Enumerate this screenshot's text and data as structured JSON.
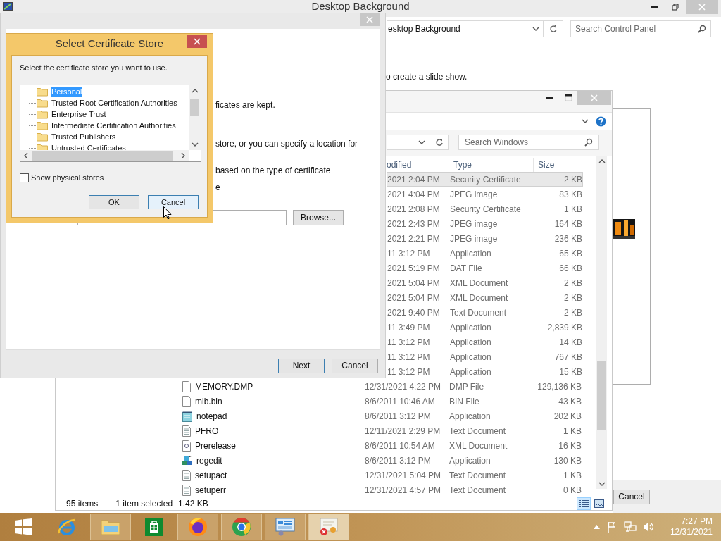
{
  "control_panel": {
    "title": "Desktop Background",
    "address": "esktop Background",
    "search_placeholder": "Search Control Panel",
    "instruction": "o create a slide show.",
    "cancel_button": "Cancel"
  },
  "explorer": {
    "search_placeholder": "Search Windows",
    "columns": [
      "odified",
      "Type",
      "Size"
    ],
    "rows": [
      {
        "kind": "covered",
        "date": "2021 2:04 PM",
        "type": "Security Certificate",
        "size": "2 KB",
        "selected": true
      },
      {
        "kind": "covered",
        "date": "2021 4:04 PM",
        "type": "JPEG image",
        "size": "83 KB",
        "selected": false
      },
      {
        "kind": "covered",
        "date": "2021 2:08 PM",
        "type": "Security Certificate",
        "size": "1 KB",
        "selected": false
      },
      {
        "kind": "covered",
        "date": "2021 2:43 PM",
        "type": "JPEG image",
        "size": "164 KB",
        "selected": false
      },
      {
        "kind": "covered",
        "date": "2021 2:21 PM",
        "type": "JPEG image",
        "size": "236 KB",
        "selected": false
      },
      {
        "kind": "covered",
        "date": "11 3:12 PM",
        "type": "Application",
        "size": "65 KB",
        "selected": false
      },
      {
        "kind": "covered",
        "date": "2021 5:19 PM",
        "type": "DAT File",
        "size": "66 KB",
        "selected": false
      },
      {
        "kind": "covered",
        "date": "2021 5:04 PM",
        "type": "XML Document",
        "size": "2 KB",
        "selected": false
      },
      {
        "kind": "covered",
        "date": "2021 5:04 PM",
        "type": "XML Document",
        "size": "2 KB",
        "selected": false
      },
      {
        "kind": "covered",
        "date": "2021 9:40 PM",
        "type": "Text Document",
        "size": "2 KB",
        "selected": false
      },
      {
        "kind": "covered",
        "date": "11 3:49 PM",
        "type": "Application",
        "size": "2,839 KB",
        "selected": false
      },
      {
        "kind": "covered",
        "date": "11 3:12 PM",
        "type": "Application",
        "size": "14 KB",
        "selected": false
      },
      {
        "kind": "covered",
        "date": "11 3:12 PM",
        "type": "Application",
        "size": "767 KB",
        "selected": false
      },
      {
        "kind": "covered",
        "date": "11 3:12 PM",
        "type": "Application",
        "size": "15 KB",
        "selected": false
      },
      {
        "kind": "blank",
        "name": "MEMORY.DMP",
        "date": "12/31/2021 4:22 PM",
        "type": "DMP File",
        "size": "129,136 KB",
        "selected": false
      },
      {
        "kind": "blank",
        "name": "mib.bin",
        "date": "8/6/2011 10:46 AM",
        "type": "BIN File",
        "size": "43 KB",
        "selected": false
      },
      {
        "kind": "app",
        "name": "notepad",
        "date": "8/6/2011 3:12 PM",
        "type": "Application",
        "size": "202 KB",
        "selected": false
      },
      {
        "kind": "text",
        "name": "PFRO",
        "date": "12/11/2021 2:29 PM",
        "type": "Text Document",
        "size": "1 KB",
        "selected": false
      },
      {
        "kind": "xml",
        "name": "Prerelease",
        "date": "8/6/2011 10:54 AM",
        "type": "XML Document",
        "size": "16 KB",
        "selected": false
      },
      {
        "kind": "registry",
        "name": "regedit",
        "date": "8/6/2011 3:12 PM",
        "type": "Application",
        "size": "130 KB",
        "selected": false
      },
      {
        "kind": "text",
        "name": "setupact",
        "date": "12/31/2021 5:04 PM",
        "type": "Text Document",
        "size": "1 KB",
        "selected": false
      },
      {
        "kind": "text",
        "name": "setuperr",
        "date": "12/31/2021 4:57 PM",
        "type": "Text Document",
        "size": "0 KB",
        "selected": false
      }
    ],
    "status": {
      "count": "95 items",
      "selection": "1 item selected",
      "selection_size": "1.42 KB"
    }
  },
  "wizard": {
    "lines": [
      "ficates are kept.",
      "store, or you can specify a location for",
      "based on the type of certificate",
      "e"
    ],
    "browse_button": "Browse...",
    "buttons": [
      {
        "label": "Next",
        "default": true
      },
      {
        "label": "Cancel",
        "default": false
      }
    ]
  },
  "store_dialog": {
    "title": "Select Certificate Store",
    "prompt": "Select the certificate store you want to use.",
    "stores": [
      {
        "label": "Personal",
        "selected": true
      },
      {
        "label": "Trusted Root Certification Authorities",
        "selected": false
      },
      {
        "label": "Enterprise Trust",
        "selected": false
      },
      {
        "label": "Intermediate Certification Authorities",
        "selected": false
      },
      {
        "label": "Trusted Publishers",
        "selected": false
      },
      {
        "label": "Untrusted Certificates",
        "selected": false
      }
    ],
    "show_physical": {
      "label": "Show physical stores",
      "checked": false
    },
    "buttons": [
      {
        "label": "OK",
        "default": true,
        "hovered": false
      },
      {
        "label": "Cancel",
        "default": false,
        "hovered": true
      }
    ]
  },
  "taskbar": {
    "items": [
      {
        "kind": "start",
        "running": false,
        "active": false
      },
      {
        "kind": "ie",
        "running": false,
        "active": false
      },
      {
        "kind": "explorer",
        "running": true,
        "active": false
      },
      {
        "kind": "store",
        "running": false,
        "active": false
      },
      {
        "kind": "firefox",
        "running": true,
        "active": false
      },
      {
        "kind": "chrome",
        "running": true,
        "active": false
      },
      {
        "kind": "control",
        "running": true,
        "active": false
      },
      {
        "kind": "cert",
        "running": true,
        "active": true
      }
    ],
    "time": "7:27 PM",
    "date": "12/31/2021"
  }
}
